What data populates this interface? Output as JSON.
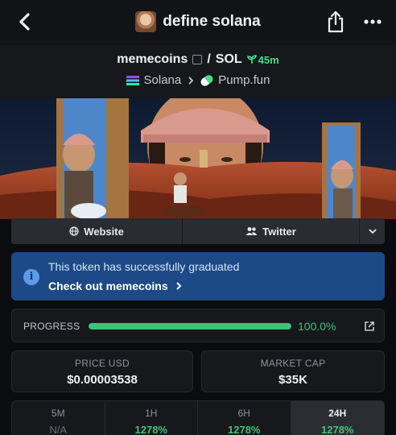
{
  "header": {
    "title": "define solana",
    "back_icon": "chevron-left-icon",
    "share_icon": "share-icon",
    "more_icon": "more-horizontal-icon"
  },
  "token": {
    "name": "memecoins",
    "quote": "SOL",
    "separator": "/",
    "age": "45m",
    "chain": "Solana",
    "dex": "Pump.fun",
    "age_color": "#3ee08a"
  },
  "links": {
    "website": "Website",
    "twitter": "Twitter"
  },
  "graduation": {
    "message": "This token has successfully graduated",
    "cta": "Check out memecoins",
    "info_icon": "i",
    "bg_color": "#1d4a86"
  },
  "progress": {
    "label": "PROGRESS",
    "value_text": "100.0%",
    "fraction": 1.0,
    "color": "#3fc37a"
  },
  "stats": {
    "price_label": "PRICE USD",
    "price_value": "$0.00003538",
    "mcap_label": "MARKET CAP",
    "mcap_value": "$35K"
  },
  "timeframes": [
    {
      "label": "5M",
      "value": "N/A"
    },
    {
      "label": "1H",
      "value": "1278%"
    },
    {
      "label": "6H",
      "value": "1278%"
    },
    {
      "label": "24H",
      "value": "1278%"
    }
  ],
  "active_timeframe": "24H"
}
